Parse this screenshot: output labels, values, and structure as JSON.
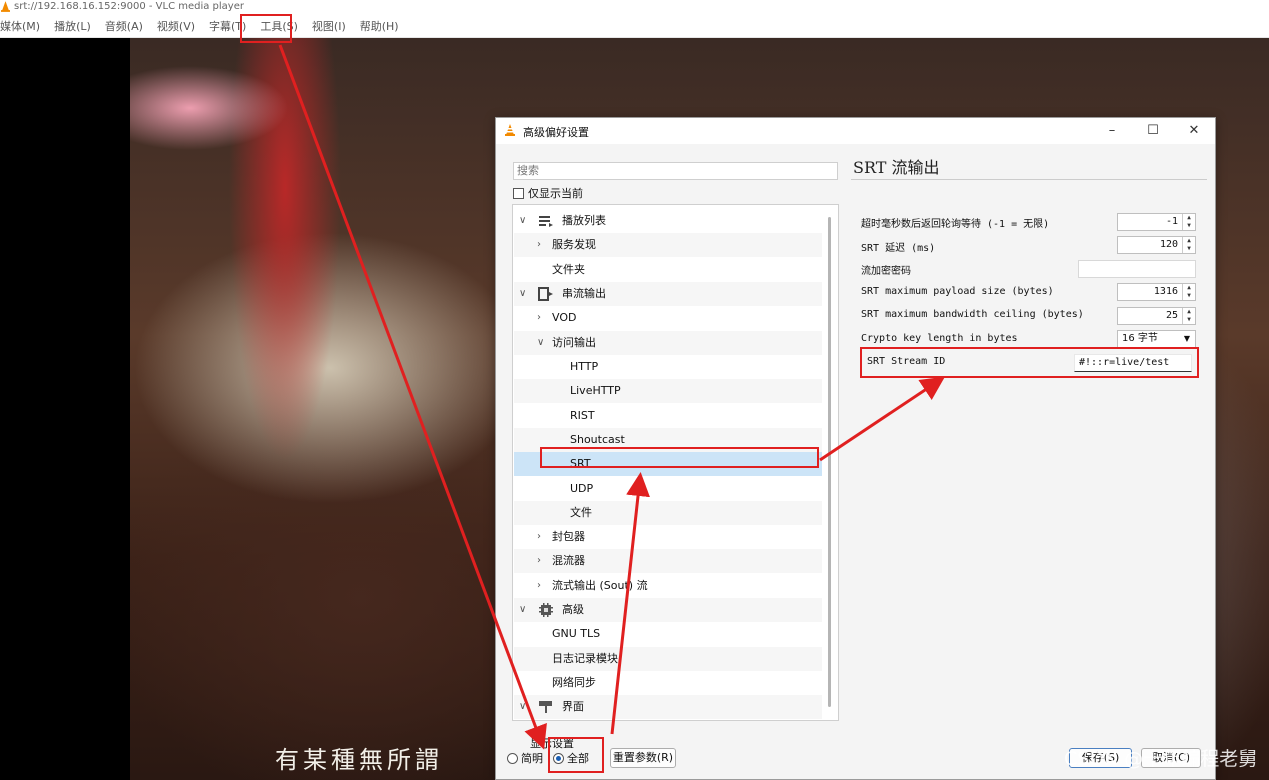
{
  "window": {
    "title": "srt://192.168.16.152:9000 - VLC media player"
  },
  "menubar": {
    "items": [
      "媒体(M)",
      "播放(L)",
      "音频(A)",
      "视频(V)",
      "字幕(T)",
      "工具(S)",
      "视图(I)",
      "帮助(H)"
    ]
  },
  "video": {
    "subtitle": "有某種無所謂"
  },
  "dialog": {
    "title": "高级偏好设置",
    "search_placeholder": "搜索",
    "only_current_label": "仅显示当前",
    "tree": [
      {
        "label": "播放列表",
        "icon": "playlist-icon",
        "arrow": "∨"
      },
      {
        "label": "服务发现",
        "arrow": "›"
      },
      {
        "label": "文件夹",
        "arrow": ""
      },
      {
        "label": "串流输出",
        "icon": "stream-output-icon",
        "arrow": "∨"
      },
      {
        "label": "VOD",
        "arrow": "›"
      },
      {
        "label": "访问输出",
        "arrow": "∨"
      },
      {
        "label": "HTTP",
        "arrow": ""
      },
      {
        "label": "LiveHTTP",
        "arrow": ""
      },
      {
        "label": "RIST",
        "arrow": ""
      },
      {
        "label": "Shoutcast",
        "arrow": ""
      },
      {
        "label": "SRT",
        "arrow": ""
      },
      {
        "label": "UDP",
        "arrow": ""
      },
      {
        "label": "文件",
        "arrow": ""
      },
      {
        "label": "封包器",
        "arrow": "›"
      },
      {
        "label": "混流器",
        "arrow": "›"
      },
      {
        "label": "流式输出 (Sout) 流",
        "arrow": "›"
      },
      {
        "label": "高级",
        "icon": "advanced-icon",
        "arrow": "∨"
      },
      {
        "label": "GNU TLS",
        "arrow": ""
      },
      {
        "label": "日志记录模块",
        "arrow": ""
      },
      {
        "label": "网络同步",
        "arrow": ""
      },
      {
        "label": "界面",
        "icon": "interface-icon",
        "arrow": "∨"
      }
    ],
    "selected_item": "SRT",
    "panel": {
      "title": "SRT 流输出",
      "settings": [
        {
          "label": "超时毫秒数后返回轮询等待 (-1 = 无限)",
          "value": "-1",
          "type": "spin"
        },
        {
          "label": "SRT 延迟 (ms)",
          "value": "120",
          "type": "spin"
        },
        {
          "label": "流加密密码",
          "value": "",
          "type": "text"
        },
        {
          "label": "SRT maximum payload size (bytes)",
          "value": "1316",
          "type": "spin"
        },
        {
          "label": "SRT maximum bandwidth ceiling (bytes)",
          "value": "25",
          "type": "spin"
        },
        {
          "label": "Crypto key length in bytes",
          "value": "16 字节",
          "type": "combo"
        },
        {
          "label": "SRT Stream ID",
          "value": "#!::r=live/test",
          "type": "text"
        }
      ]
    },
    "show_settings_label": "显示设置",
    "simple_label": "简明",
    "all_label": "全部",
    "reset_label": "重置参数(R)",
    "save_label": "保存(S)",
    "cancel_label": "取消(C)"
  },
  "watermark": "CSDN @十年编程老舅",
  "annotation_color": "#e02020"
}
